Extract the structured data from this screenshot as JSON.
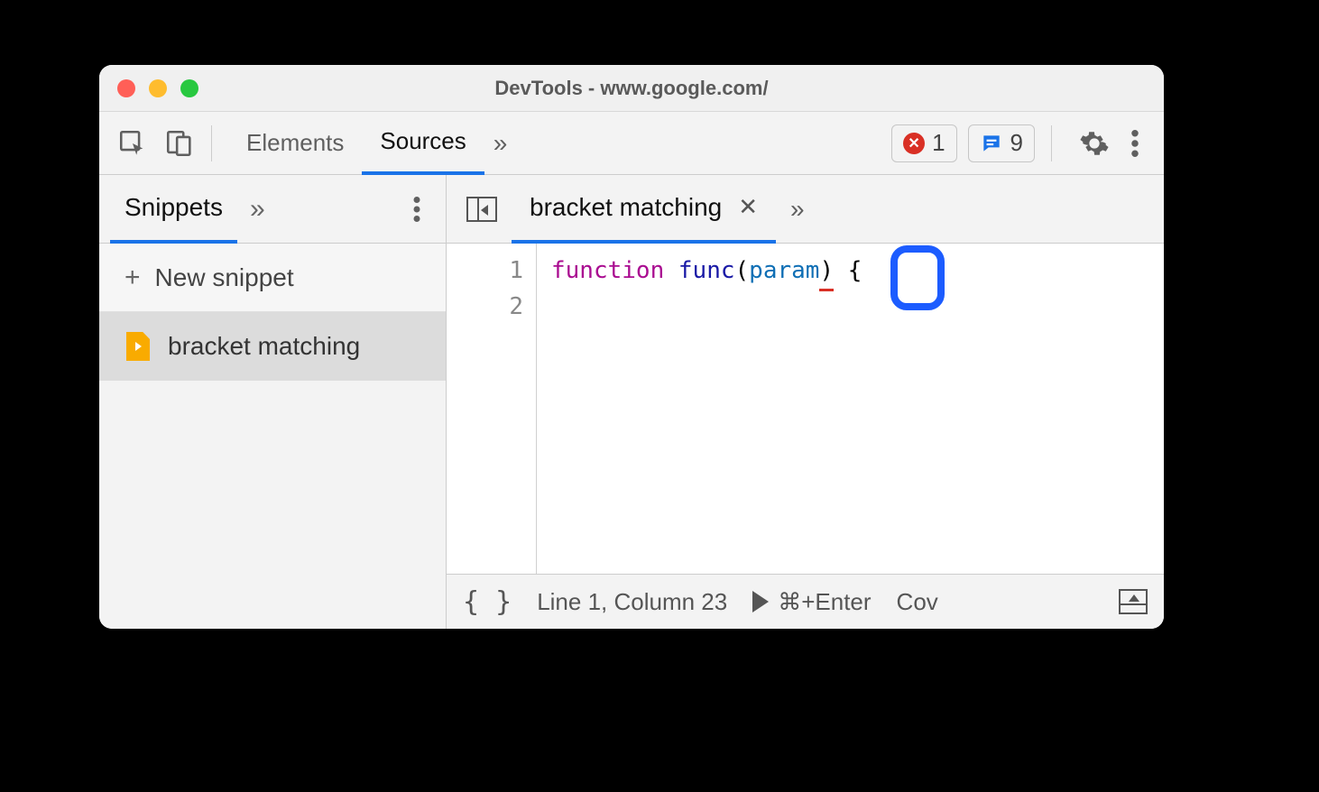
{
  "window": {
    "title": "DevTools - www.google.com/"
  },
  "toolbar": {
    "tab_elements": "Elements",
    "tab_sources": "Sources",
    "more_tabs_glyph": "»",
    "error_count": "1",
    "info_count": "9"
  },
  "sidebar": {
    "tab_label": "Snippets",
    "more_glyph": "»",
    "new_snippet_label": "New snippet",
    "items": [
      {
        "label": "bracket matching"
      }
    ]
  },
  "editor": {
    "tab_label": "bracket matching",
    "more_glyph": "»",
    "gutter": [
      "1",
      "2"
    ],
    "code": {
      "keyword": "function",
      "space1": " ",
      "name": "func",
      "open_paren": "(",
      "param": "param",
      "close_paren": ")",
      "space2": " ",
      "brace": "{"
    }
  },
  "status": {
    "braces": "{ }",
    "position": "Line 1, Column 23",
    "run_hint": "⌘+Enter",
    "coverage": "Cov"
  }
}
